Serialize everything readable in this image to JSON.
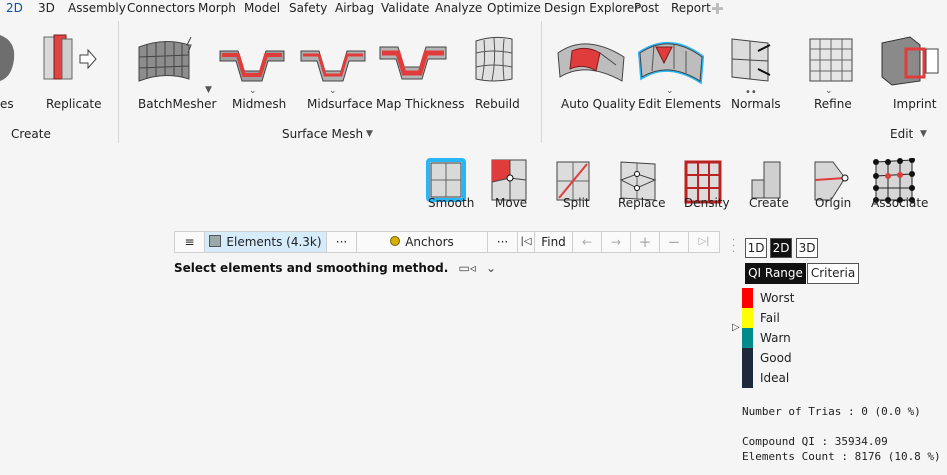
{
  "menu": [
    "2D",
    "3D",
    "Assembly",
    "Connectors",
    "Morph",
    "Model",
    "Safety",
    "Airbag",
    "Validate",
    "Analyze",
    "Optimize",
    "Design Explorer",
    "Post",
    "Report"
  ],
  "ribbon": {
    "tools": {
      "partial": "es",
      "replicate": "Replicate",
      "batchmesher": "BatchMesher",
      "midmesh": "Midmesh",
      "midsurface": "Midsurface",
      "mapthickness": "Map Thickness",
      "rebuild": "Rebuild",
      "autoquality": "Auto Quality",
      "editelements": "Edit Elements",
      "normals": "Normals",
      "refine": "Refine",
      "imprint": "Imprint"
    },
    "groups": {
      "create": "Create",
      "surfacemesh": "Surface Mesh",
      "edit": "Edit"
    }
  },
  "subtools": {
    "smooth": "Smooth",
    "move": "Move",
    "split": "Split",
    "replace": "Replace",
    "density": "Density",
    "create": "Create",
    "origin": "Origin",
    "associate": "Associate"
  },
  "selector": {
    "elements": "Elements (4.3k)",
    "more1": "···",
    "anchors": "Anchors",
    "more2": "···",
    "find": "Find"
  },
  "hint": "Select elements and smoothing method.",
  "panel": {
    "dims": [
      "1D",
      "2D",
      "3D"
    ],
    "qirange": "QI Range",
    "criteria": "Criteria",
    "legend": [
      {
        "label": "Worst",
        "color": "#ff0000"
      },
      {
        "label": "Fail",
        "color": "#ffff00"
      },
      {
        "label": "Warn",
        "color": "#008b8b"
      },
      {
        "label": "Good",
        "color": "#1c2a3c"
      },
      {
        "label": "Ideal",
        "color": "#1c2a3c"
      }
    ],
    "trias": "Number of Trias : 0 (0.0 %)",
    "compound": "Compound QI : 35934.09",
    "count": "Elements Count : 8176 (10.8 %)"
  },
  "colors": {
    "accent": "#0a4fa0",
    "selected_bg": "#d6ecfb",
    "highlight": "#29b6f6"
  }
}
